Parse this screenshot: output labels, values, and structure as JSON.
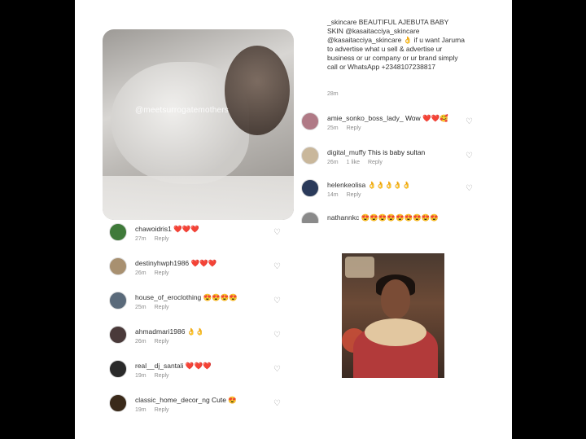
{
  "post": {
    "watermark": "@meetsurrogatemothers",
    "caption": "_skincare BEAUTIFUL AJEBUTA BABY SKIN @kasaitacciya_skincare @kasaitacciya_skincare 👌 if u want Jaruma to advertise what u sell & advertise ur business or ur company or ur brand simply call or WhatsApp +2348107238817",
    "caption_time": "28m"
  },
  "right_comments": [
    {
      "user": "amie_sonko_boss_lady_",
      "text": "Wow ❤️❤️🥰",
      "time": "25m",
      "reply": "Reply",
      "likes": "",
      "avatar_color": "#b07a86"
    },
    {
      "user": "digital_muffy",
      "text": "This is baby sultan",
      "time": "26m",
      "reply": "Reply",
      "likes": "1 like",
      "avatar_color": "#c9b79b"
    },
    {
      "user": "helenkeolisa",
      "text": "👌👌👌👌👌",
      "time": "14m",
      "reply": "Reply",
      "likes": "",
      "avatar_color": "#2a3a5a"
    },
    {
      "user": "nathannkc",
      "text": "😍😍😍😍😍😍😍😍😍",
      "time": "",
      "reply": "",
      "likes": "",
      "avatar_color": "#8a8a8a"
    }
  ],
  "left_comments": [
    {
      "user": "chawoidris1",
      "text": "❤️❤️❤️",
      "time": "27m",
      "reply": "Reply",
      "avatar_color": "#3f7a3a"
    },
    {
      "user": "destinyhwph1986",
      "text": "❤️❤️❤️",
      "time": "26m",
      "reply": "Reply",
      "avatar_color": "#a89070"
    },
    {
      "user": "house_of_eroclothing",
      "text": "😍😍😍😍",
      "time": "25m",
      "reply": "Reply",
      "avatar_color": "#5a6a7a"
    },
    {
      "user": "ahmadmari1986",
      "text": "👌👌",
      "time": "26m",
      "reply": "Reply",
      "avatar_color": "#4a3a3a"
    },
    {
      "user": "real__dj_santali",
      "text": "❤️❤️❤️",
      "time": "19m",
      "reply": "Reply",
      "avatar_color": "#2a2a2a"
    },
    {
      "user": "classic_home_decor_ng",
      "text": "Cute 😍",
      "time": "19m",
      "reply": "Reply",
      "avatar_color": "#3a2a1a"
    }
  ],
  "colors": {
    "background": "#000000",
    "panel": "#ffffff",
    "meta_text": "#8e8e8e"
  },
  "icons": {
    "like": "heart-outline-icon"
  }
}
